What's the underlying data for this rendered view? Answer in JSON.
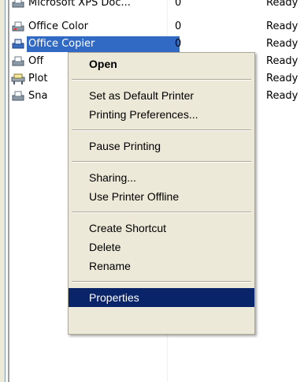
{
  "printers": [
    {
      "name": "Microsoft XPS Doc...",
      "docs": "0",
      "status": "Ready",
      "icon": "printer-icon"
    },
    {
      "name": "Office Color",
      "docs": "0",
      "status": "Ready",
      "icon": "printer-icon"
    },
    {
      "name": "Office Copier",
      "docs": "0",
      "status": "Ready",
      "icon": "printer-icon",
      "selected": true
    },
    {
      "name": "Off",
      "docs": "",
      "status": "Ready",
      "icon": "printer-icon"
    },
    {
      "name": "Plot",
      "docs": "",
      "status": "Ready",
      "icon": "plotter-icon"
    },
    {
      "name": "Sna",
      "docs": "",
      "status": "Ready",
      "icon": "printer-icon"
    }
  ],
  "context_menu": {
    "open": "Open",
    "set_default": "Set as Default Printer",
    "preferences": "Printing Preferences...",
    "pause": "Pause Printing",
    "sharing": "Sharing...",
    "offline": "Use Printer Offline",
    "create_shortcut": "Create Shortcut",
    "delete": "Delete",
    "rename": "Rename",
    "properties": "Properties"
  },
  "colors": {
    "selection": "#316ac5",
    "menu_highlight": "#0a246a",
    "menu_bg": "#ece9d8"
  }
}
